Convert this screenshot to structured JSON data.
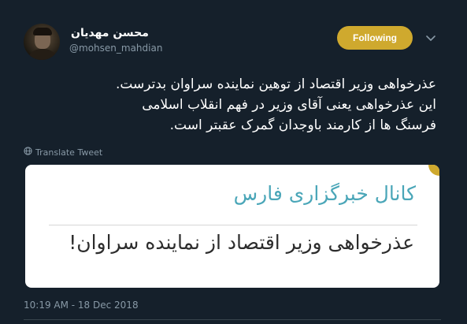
{
  "author": {
    "display_name": "محسن مهدیان",
    "handle": "@mohsen_mahdian",
    "avatar_icon": "profile-photo"
  },
  "follow_button": {
    "label": "Following",
    "color": "#cfa92e"
  },
  "caret_icon": "chevron-down-icon",
  "tweet": {
    "lines": [
      "عذرخواهی وزیر اقتصاد از توهین نماینده سراوان بدترست.",
      "این عذرخواهی یعنی آقای وزیر  در فهم انقلاب اسلامی",
      "فرسنگ ها از کارمند باوجدان گمرک عقبتر است."
    ],
    "translate_label": "Translate Tweet",
    "translate_icon": "globe-icon",
    "timestamp": "10:19 AM - 18 Dec 2018"
  },
  "media_card": {
    "title": "کانال خبرگزاری فارس",
    "body": "عذرخواهی وزیر اقتصاد از نماینده سراوان!",
    "title_color": "#4aa6b8",
    "body_color": "#2d2d2d"
  },
  "colors": {
    "background": "#15202b",
    "muted_text": "#8899a6",
    "divider": "#38444d"
  }
}
